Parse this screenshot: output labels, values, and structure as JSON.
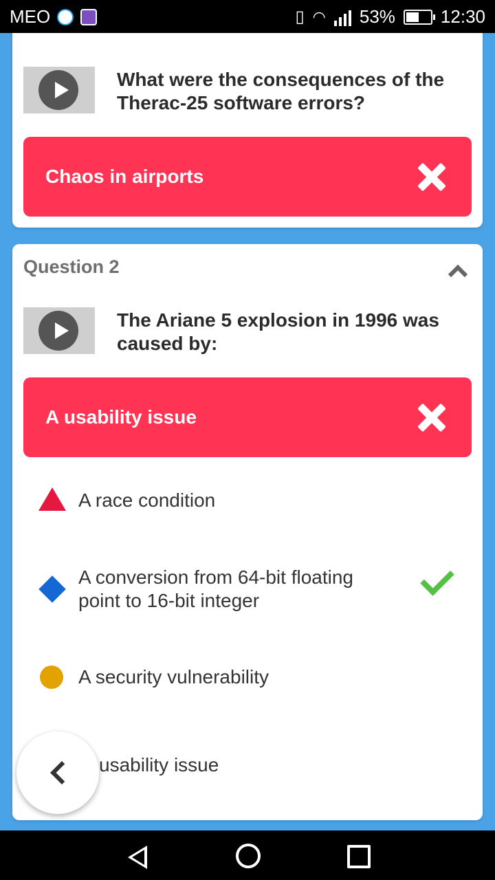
{
  "status_bar": {
    "carrier": "MEO",
    "battery": "53%",
    "time": "12:30"
  },
  "question1": {
    "question_text": "What were the consequences of the Therac-25 software errors?",
    "selected_answer": "Chaos in airports",
    "answer_color": "#ff3455"
  },
  "question2": {
    "header": "Question 2",
    "question_text": "The Ariane 5 explosion in 1996 was caused by:",
    "selected_answer": "A usability issue",
    "options": [
      {
        "label": "A race condition",
        "shape": "triangle",
        "color": "#e5183f"
      },
      {
        "label": "A conversion from 64-bit floating point to 16-bit integer",
        "shape": "diamond",
        "color": "#1567d3",
        "correct": true
      },
      {
        "label": "A security vulnerability",
        "shape": "circle",
        "color": "#e2a200"
      },
      {
        "label": "usability issue",
        "shape": "square"
      }
    ]
  },
  "colors": {
    "background": "#4aa3e6",
    "wrong": "#ff3455",
    "correct": "#54c144"
  }
}
